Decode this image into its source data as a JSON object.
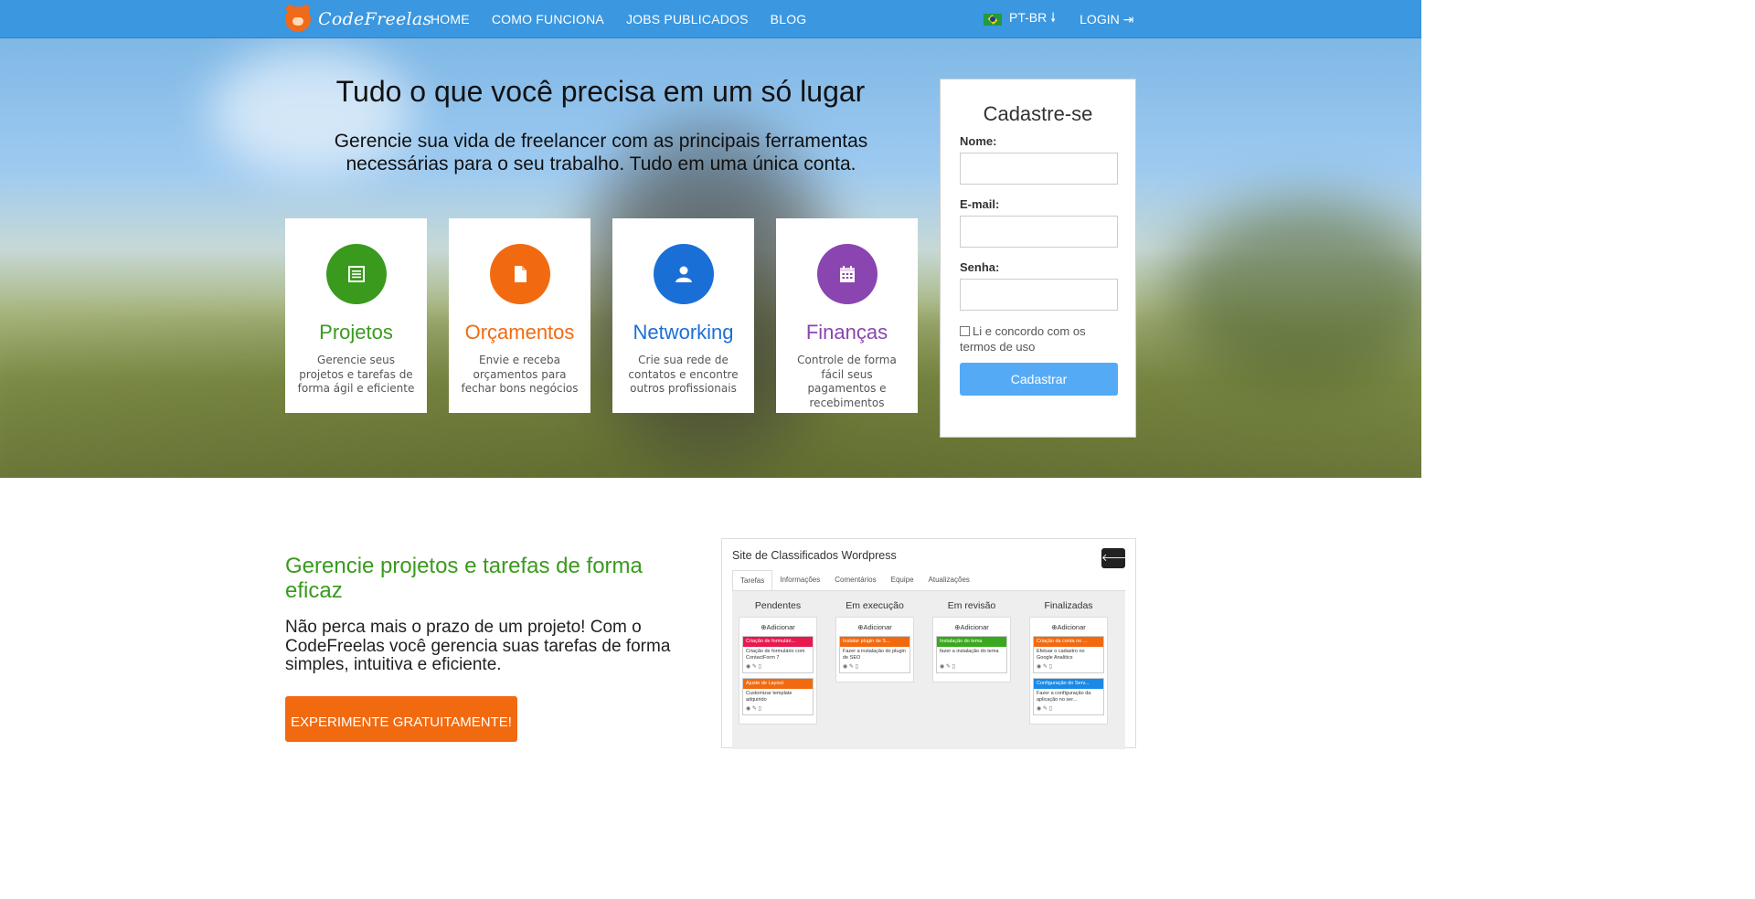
{
  "nav": {
    "brand": "CodeFreelas",
    "links": [
      "HOME",
      "COMO FUNCIONA",
      "JOBS PUBLICADOS",
      "BLOG"
    ],
    "language": "PT-BR",
    "login": "LOGIN"
  },
  "hero": {
    "title": "Tudo o que você precisa em um só lugar",
    "subtitle": "Gerencie sua vida de freelancer com as principais ferramentas necessárias para o seu trabalho. Tudo em uma única conta.",
    "features": [
      {
        "title": "Projetos",
        "desc": "Gerencie seus projetos e tarefas de forma ágil e eficiente",
        "color": "#3a9a1e",
        "icon": "list-icon"
      },
      {
        "title": "Orçamentos",
        "desc": "Envie e receba orçamentos para fechar bons negócios",
        "color": "#f26a10",
        "icon": "document-icon"
      },
      {
        "title": "Networking",
        "desc": "Crie sua rede de contatos e encontre outros profissionais",
        "color": "#1a6fd6",
        "icon": "user-icon"
      },
      {
        "title": "Finanças",
        "desc": "Controle de forma fácil seus pagamentos e recebimentos",
        "color": "#8a45b0",
        "icon": "calendar-icon"
      }
    ]
  },
  "signup": {
    "title": "Cadastre-se",
    "name_label": "Nome:",
    "email_label": "E-mail:",
    "password_label": "Senha:",
    "terms": "Li e concordo com os termos de uso",
    "submit": "Cadastrar"
  },
  "section": {
    "title": "Gerencie projetos e tarefas de forma eficaz",
    "text": "Não perca mais o prazo de um projeto! Com o CodeFreelas você gerencia suas tarefas de forma simples, intuitiva e eficiente.",
    "cta": "EXPERIMENTE GRATUITAMENTE!"
  },
  "screenshot": {
    "title": "Site de Classificados Wordpress",
    "back_icon": "arrow-left-icon",
    "tabs": [
      "Tarefas",
      "Informações",
      "Comentários",
      "Equipe",
      "Atualizações"
    ],
    "add_label": "Adicionar",
    "columns": [
      {
        "name": "Pendentes",
        "cards": [
          {
            "title": "Criação de formulári...",
            "body": "Criação de formulário com ContactForm 7",
            "color": "#e8194f"
          },
          {
            "title": "Ajuste de Layout",
            "body": "Customizar template adquirido",
            "color": "#f26a10"
          }
        ]
      },
      {
        "name": "Em execução",
        "cards": [
          {
            "title": "Instalar plugin de S...",
            "body": "Fazer a instalação do plugin de SEO",
            "color": "#f26a10"
          }
        ]
      },
      {
        "name": "Em revisão",
        "cards": [
          {
            "title": "Instalação do tema",
            "body": "fazer a instalação do tema",
            "color": "#3aa81e"
          }
        ]
      },
      {
        "name": "Finalizadas",
        "cards": [
          {
            "title": "Criação da conta no ...",
            "body": "Efetuar o cadastro no Google Analitics",
            "color": "#f26a10"
          },
          {
            "title": "Configuração do Serv...",
            "body": "Fazer a configuração da aplicação no ser...",
            "color": "#1a8ae6"
          }
        ]
      }
    ]
  }
}
